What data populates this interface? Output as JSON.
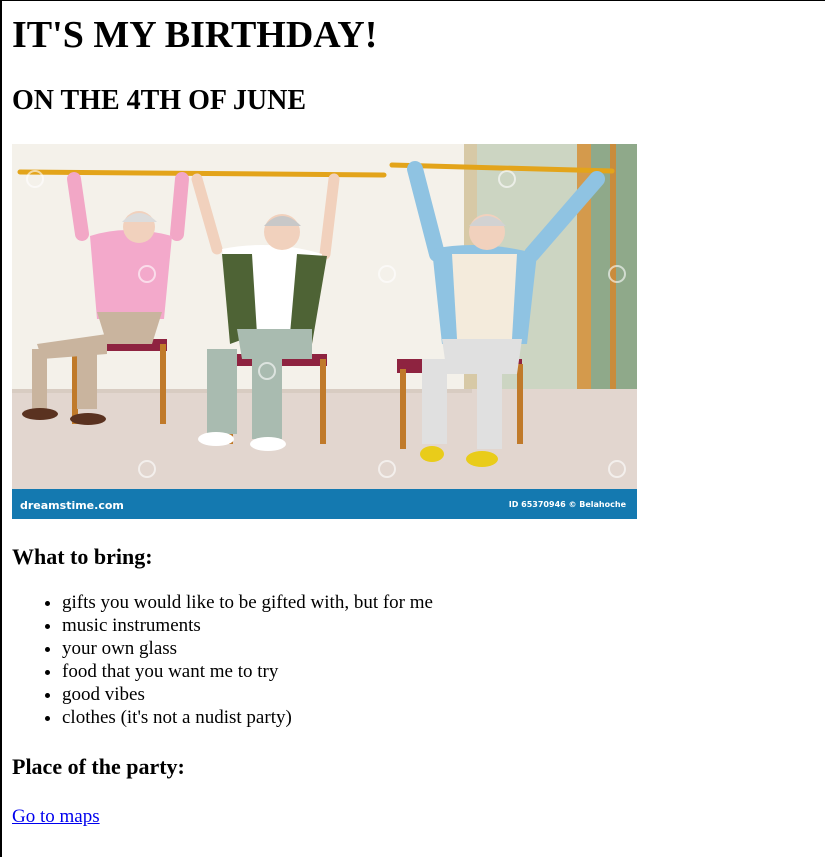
{
  "page": {
    "title": "IT'S MY BIRTHDAY!",
    "subtitle": "ON THE 4TH OF JUNE"
  },
  "photo": {
    "watermark_brand": "dreamstime.com",
    "watermark_id": "ID 65370946 © Belahoche"
  },
  "bring": {
    "heading": "What to bring:",
    "items": [
      "gifts you would like to be gifted with, but for me",
      "music instruments",
      "your own glass",
      "food that you want me to try",
      "good vibes",
      "clothes (it's not a nudist party)"
    ]
  },
  "place": {
    "heading": "Place of the party:",
    "link_label": "Go to maps"
  },
  "colors": {
    "link": "#0000ee",
    "watermark_bar": "#1479b0"
  }
}
